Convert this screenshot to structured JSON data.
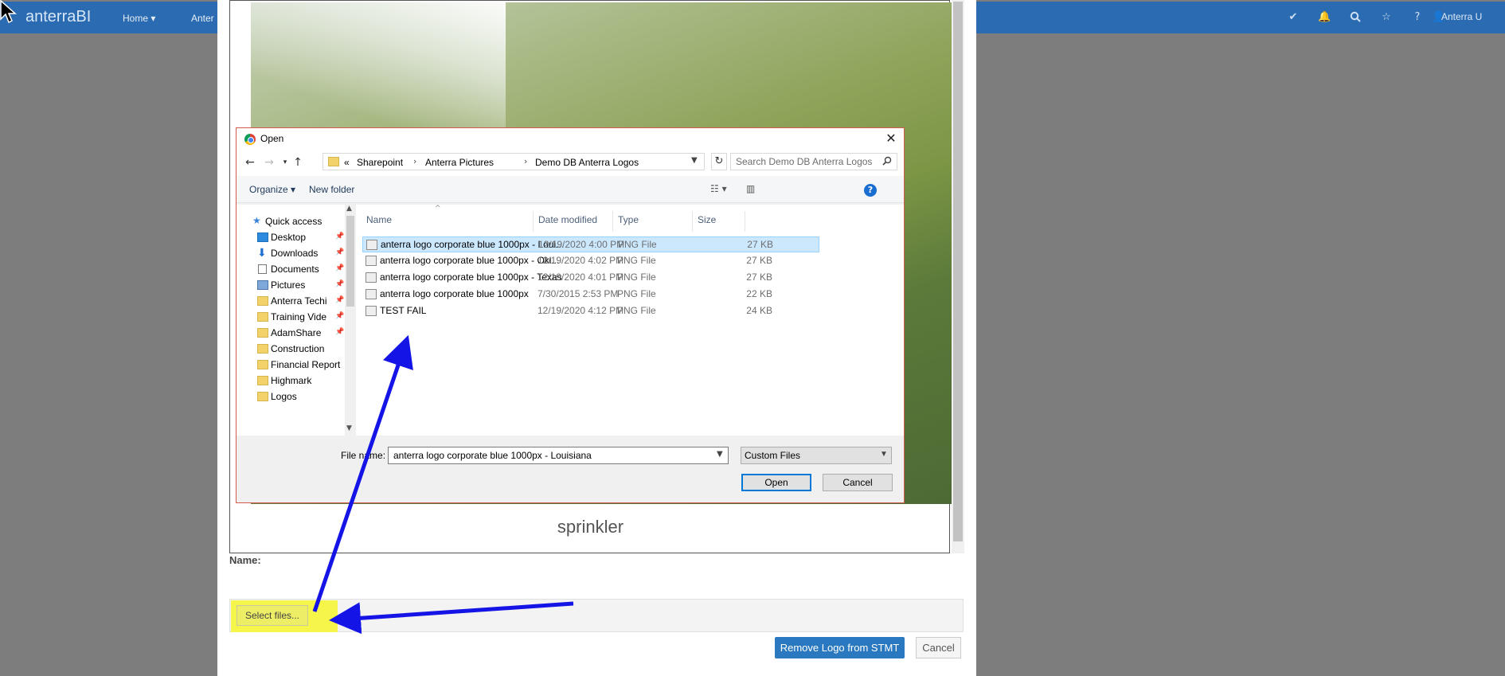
{
  "app": {
    "brand": "anterraBI",
    "nav": {
      "home": "Home ▾",
      "second": "Anter"
    },
    "user_label": "Anterra U",
    "icons": [
      "check-icon",
      "bell-icon",
      "search-icon",
      "star-icon",
      "help-icon",
      "user-icon"
    ]
  },
  "modal": {
    "image_caption": "sprinkler",
    "name_label": "Name:",
    "select_files_label": "Select files...",
    "remove_logo_label": "Remove Logo from STMT",
    "cancel_label": "Cancel"
  },
  "dialog": {
    "title": "Open",
    "breadcrumb": {
      "overflow": "«",
      "parts": [
        "Sharepoint",
        "Anterra Pictures",
        "Demo DB Anterra Logos"
      ]
    },
    "search_placeholder": "Search Demo DB Anterra Logos",
    "toolbar": {
      "organize": "Organize ▾",
      "new_folder": "New folder"
    },
    "nav_items": [
      {
        "label": "Quick access",
        "icon": "star-icon",
        "pinned": false
      },
      {
        "label": "Desktop",
        "icon": "desktop-icon",
        "pinned": true
      },
      {
        "label": "Downloads",
        "icon": "download-icon",
        "pinned": true
      },
      {
        "label": "Documents",
        "icon": "documents-icon",
        "pinned": true
      },
      {
        "label": "Pictures",
        "icon": "pictures-icon",
        "pinned": true
      },
      {
        "label": "Anterra Techi",
        "icon": "folder-icon",
        "pinned": true
      },
      {
        "label": "Training Vide",
        "icon": "folder-icon",
        "pinned": true
      },
      {
        "label": "AdamShare",
        "icon": "folder-icon",
        "pinned": true
      },
      {
        "label": "Construction",
        "icon": "folder-icon",
        "pinned": false
      },
      {
        "label": "Financial Report",
        "icon": "folder-icon",
        "pinned": false
      },
      {
        "label": "Highmark",
        "icon": "folder-icon",
        "pinned": false
      },
      {
        "label": "Logos",
        "icon": "folder-icon",
        "pinned": false
      }
    ],
    "columns": {
      "name": "Name",
      "date": "Date modified",
      "type": "Type",
      "size": "Size"
    },
    "files": [
      {
        "name": "anterra logo corporate blue 1000px - Loui...",
        "date": "12/19/2020 4:00 PM",
        "type": "PNG File",
        "size": "27 KB",
        "selected": true
      },
      {
        "name": "anterra logo corporate blue 1000px - Okl...",
        "date": "12/19/2020 4:02 PM",
        "type": "PNG File",
        "size": "27 KB",
        "selected": false
      },
      {
        "name": "anterra logo corporate blue 1000px - Texas",
        "date": "12/19/2020 4:01 PM",
        "type": "PNG File",
        "size": "27 KB",
        "selected": false
      },
      {
        "name": "anterra logo corporate blue 1000px",
        "date": "7/30/2015 2:53 PM",
        "type": "PNG File",
        "size": "22 KB",
        "selected": false
      },
      {
        "name": "TEST FAIL",
        "date": "12/19/2020 4:12 PM",
        "type": "PNG File",
        "size": "24 KB",
        "selected": false
      }
    ],
    "file_name_label": "File name:",
    "file_name_value": "anterra logo corporate blue 1000px - Louisiana",
    "filter_value": "Custom Files",
    "open_label": "Open",
    "cancel_label": "Cancel"
  },
  "colors": {
    "navbar": "#2b6bb2",
    "highlight": "#f5f54a",
    "arrow": "#1414e6",
    "primary_button": "#2a79c0",
    "selection": "#cce8ff"
  }
}
